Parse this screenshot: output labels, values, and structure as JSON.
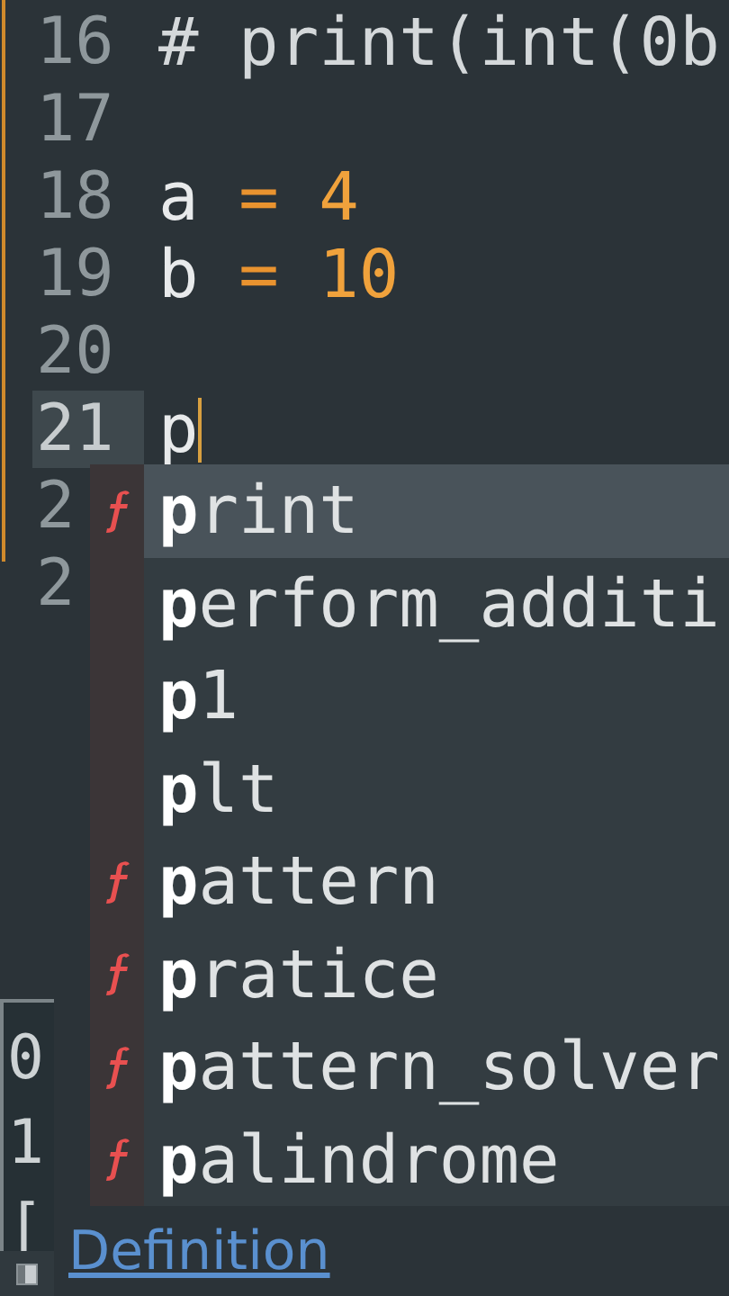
{
  "editor": {
    "lines": [
      {
        "number": "16",
        "current": false,
        "tokens": [
          {
            "kind": "comment",
            "text": "# print(int(0b"
          }
        ]
      },
      {
        "number": "17",
        "current": false
      },
      {
        "number": "18",
        "current": false,
        "tokens": [
          {
            "kind": "name",
            "text": "a "
          },
          {
            "kind": "operator",
            "text": "="
          },
          {
            "kind": "number",
            "text": " 4"
          }
        ]
      },
      {
        "number": "19",
        "current": false,
        "tokens": [
          {
            "kind": "name",
            "text": "b "
          },
          {
            "kind": "operator",
            "text": "="
          },
          {
            "kind": "number",
            "text": " 10"
          }
        ]
      },
      {
        "number": "20",
        "current": false
      },
      {
        "number": "21",
        "current": true,
        "tokens": [
          {
            "kind": "name",
            "text": "p"
          }
        ]
      },
      {
        "number": "2",
        "current": false
      },
      {
        "number": "2",
        "current": false
      }
    ]
  },
  "autocomplete": {
    "items": [
      {
        "kind": "function",
        "label": "**p**rint",
        "selected": true
      },
      {
        "kind": "other",
        "label": "**p**erform_additi",
        "selected": false
      },
      {
        "kind": "other",
        "label": "**p**1",
        "selected": false
      },
      {
        "kind": "other",
        "label": "**p**lt",
        "selected": false
      },
      {
        "kind": "function",
        "label": "**p**attern",
        "selected": false
      },
      {
        "kind": "function",
        "label": "**p**ratice",
        "selected": false
      },
      {
        "kind": "function",
        "label": "**p**attern_solver",
        "selected": false
      },
      {
        "kind": "function",
        "label": "**p**alindrome",
        "selected": false
      }
    ]
  },
  "console": {
    "lines": [
      "0",
      "1",
      "["
    ]
  },
  "definition_link": "Definition"
}
